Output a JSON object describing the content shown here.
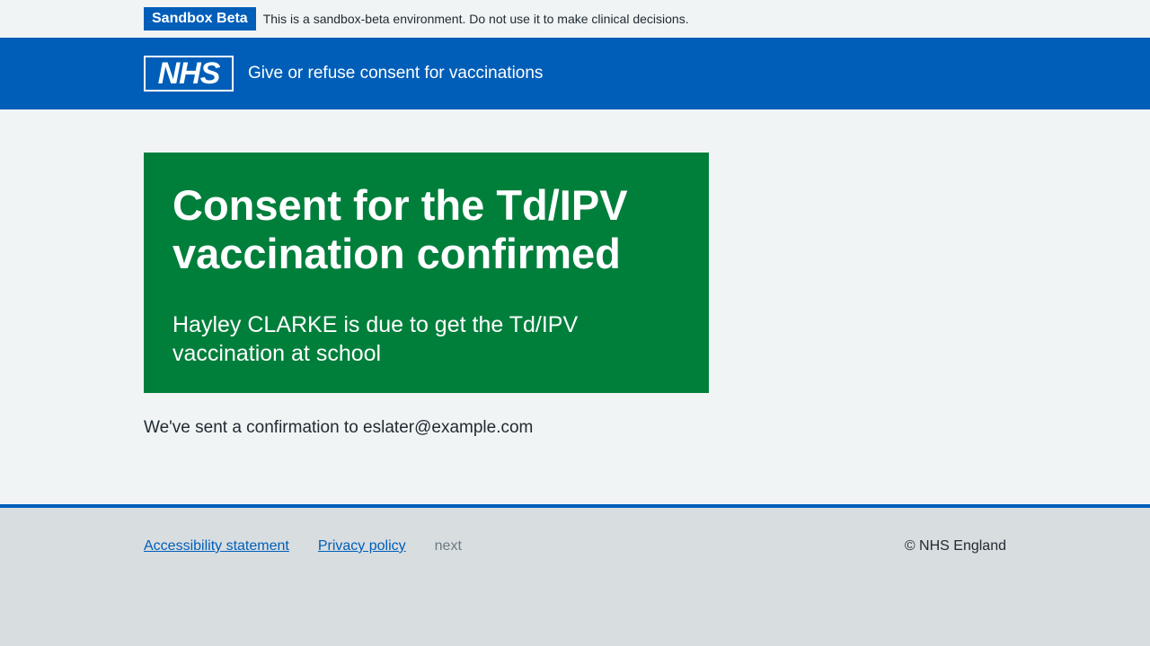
{
  "env_banner": {
    "tag": "Sandbox Beta",
    "message": "This is a sandbox-beta environment. Do not use it to make clinical decisions."
  },
  "header": {
    "logo_text": "NHS",
    "service_name": "Give or refuse consent for vaccinations"
  },
  "panel": {
    "title": "Consent for the Td/IPV vaccination confirmed",
    "body": "Hayley CLARKE is due to get the Td/IPV vaccination at school"
  },
  "confirmation": "We've sent a confirmation to eslater@example.com",
  "footer": {
    "links": [
      "Accessibility statement",
      "Privacy policy"
    ],
    "version": "next",
    "copyright": "© NHS England"
  },
  "colors": {
    "nhs_blue": "#005eb8",
    "success_green": "#007f3b",
    "page_bg": "#f0f4f5",
    "footer_bg": "#d8dde0"
  }
}
